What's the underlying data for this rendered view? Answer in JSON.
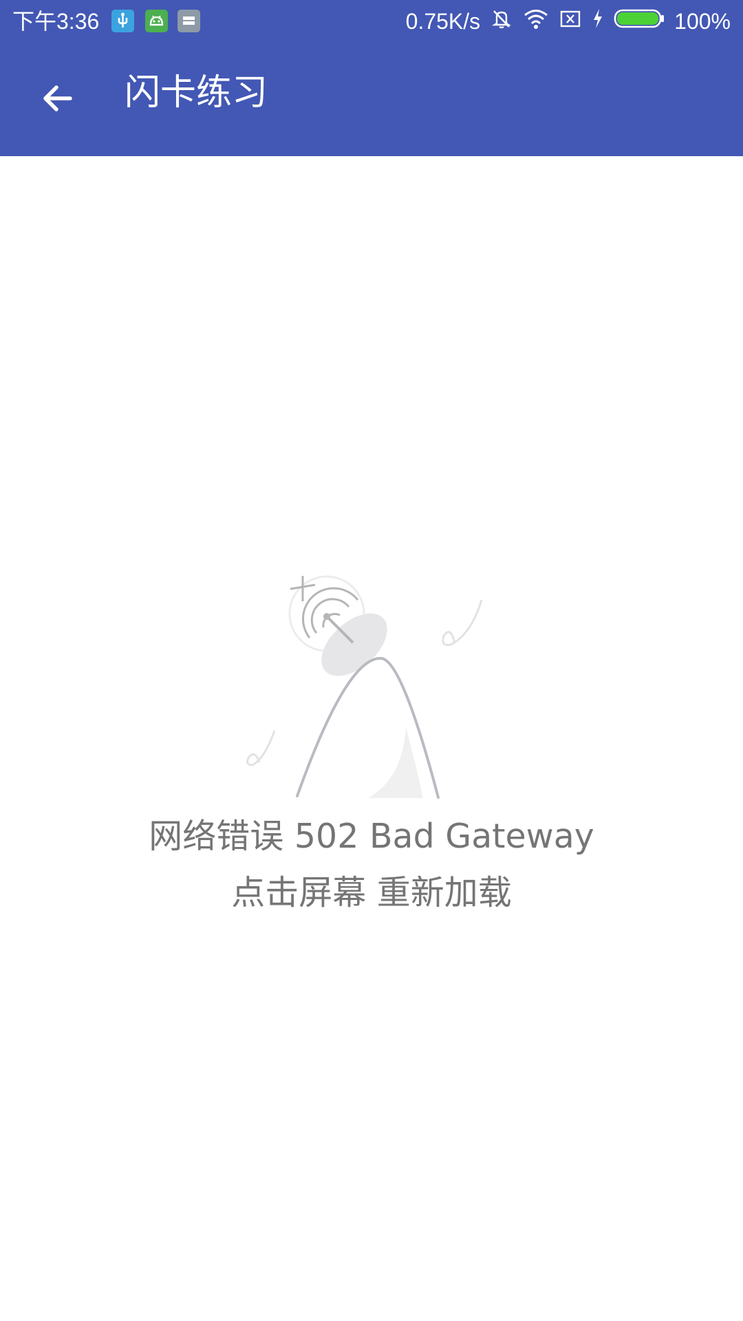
{
  "status_bar": {
    "time": "下午3:36",
    "network_speed": "0.75K/s",
    "battery_percent": "100%",
    "battery_level": 1.0,
    "left_icons": [
      "usb-debug-icon",
      "android-icon",
      "storage-icon"
    ],
    "right_icons": [
      "mute-icon",
      "wifi-icon",
      "no-sim-icon",
      "charging-icon",
      "battery-icon"
    ],
    "colors": {
      "usb_icon_bg": "#3ba3e0",
      "android_icon_bg": "#4caf50",
      "storage_icon_bg": "#8e9aa6",
      "battery_fill": "#4cd137"
    }
  },
  "app_bar": {
    "title": "闪卡练习",
    "back_icon": "arrow-back-icon",
    "color": "#4358b4"
  },
  "error": {
    "illustration": "satellite-dish-icon",
    "message": "网络错误 502 Bad Gateway",
    "action": "点击屏幕 重新加载",
    "text_color": "#757575"
  }
}
